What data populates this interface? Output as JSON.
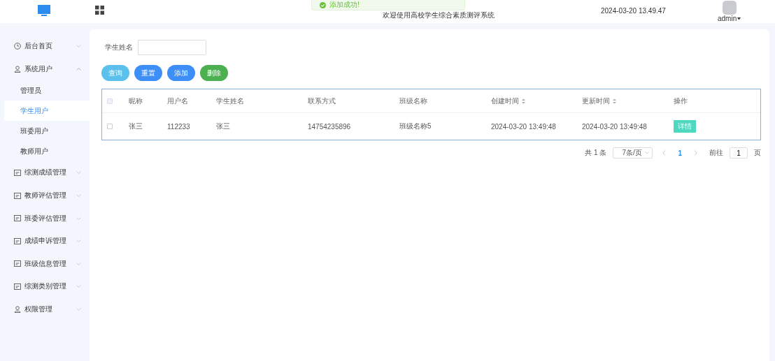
{
  "header": {
    "title": "欢迎使用高校学生综合素质测评系统",
    "datetime": "2024-03-20 13.49.47",
    "user": "admin"
  },
  "toast": {
    "message": "添加成功!"
  },
  "sidebar": {
    "items": [
      {
        "label": "后台首页",
        "kind": "clock",
        "expanded": false
      },
      {
        "label": "系统用户",
        "kind": "user",
        "expanded": true,
        "children": [
          {
            "label": "管理员",
            "selected": false
          },
          {
            "label": "学生用户",
            "selected": true
          },
          {
            "label": "班委用户",
            "selected": false
          },
          {
            "label": "教师用户",
            "selected": false
          }
        ]
      },
      {
        "label": "综测成绩管理",
        "kind": "doc",
        "expanded": false
      },
      {
        "label": "教师评估管理",
        "kind": "doc",
        "expanded": false
      },
      {
        "label": "班委评估管理",
        "kind": "doc",
        "expanded": false
      },
      {
        "label": "成绩申诉管理",
        "kind": "doc",
        "expanded": false
      },
      {
        "label": "班级信息管理",
        "kind": "doc",
        "expanded": false
      },
      {
        "label": "综测类别管理",
        "kind": "doc",
        "expanded": false
      },
      {
        "label": "权限管理",
        "kind": "user",
        "expanded": false
      }
    ]
  },
  "search": {
    "label": "学生姓名"
  },
  "buttons": [
    {
      "label": "查询",
      "kind": "info"
    },
    {
      "label": "重置",
      "kind": "primary"
    },
    {
      "label": "添加",
      "kind": "primary"
    },
    {
      "label": "删除",
      "kind": "success"
    }
  ],
  "table": {
    "columns": [
      {
        "label": "昵称",
        "sortable": false
      },
      {
        "label": "用户名",
        "sortable": false
      },
      {
        "label": "学生姓名",
        "sortable": false
      },
      {
        "label": "联系方式",
        "sortable": false
      },
      {
        "label": "班级名称",
        "sortable": false
      },
      {
        "label": "创建时间",
        "sortable": true
      },
      {
        "label": "更新时间",
        "sortable": true
      },
      {
        "label": "操作",
        "sortable": false
      }
    ],
    "all_checked": false,
    "rows": [
      {
        "checked": false,
        "cells": [
          "张三",
          "112233",
          "张三",
          "14754235896",
          "班级名称5",
          "2024-03-20 13:49:48",
          "2024-03-20 13:49:48"
        ],
        "action": "详情"
      }
    ]
  },
  "pagination": {
    "total": "共 1 条",
    "page_size": "7条/页",
    "pages": [
      {
        "label": "1",
        "selected": true
      }
    ],
    "goto_label": "前往",
    "goto_value": "1",
    "goto_suffix": "页"
  }
}
